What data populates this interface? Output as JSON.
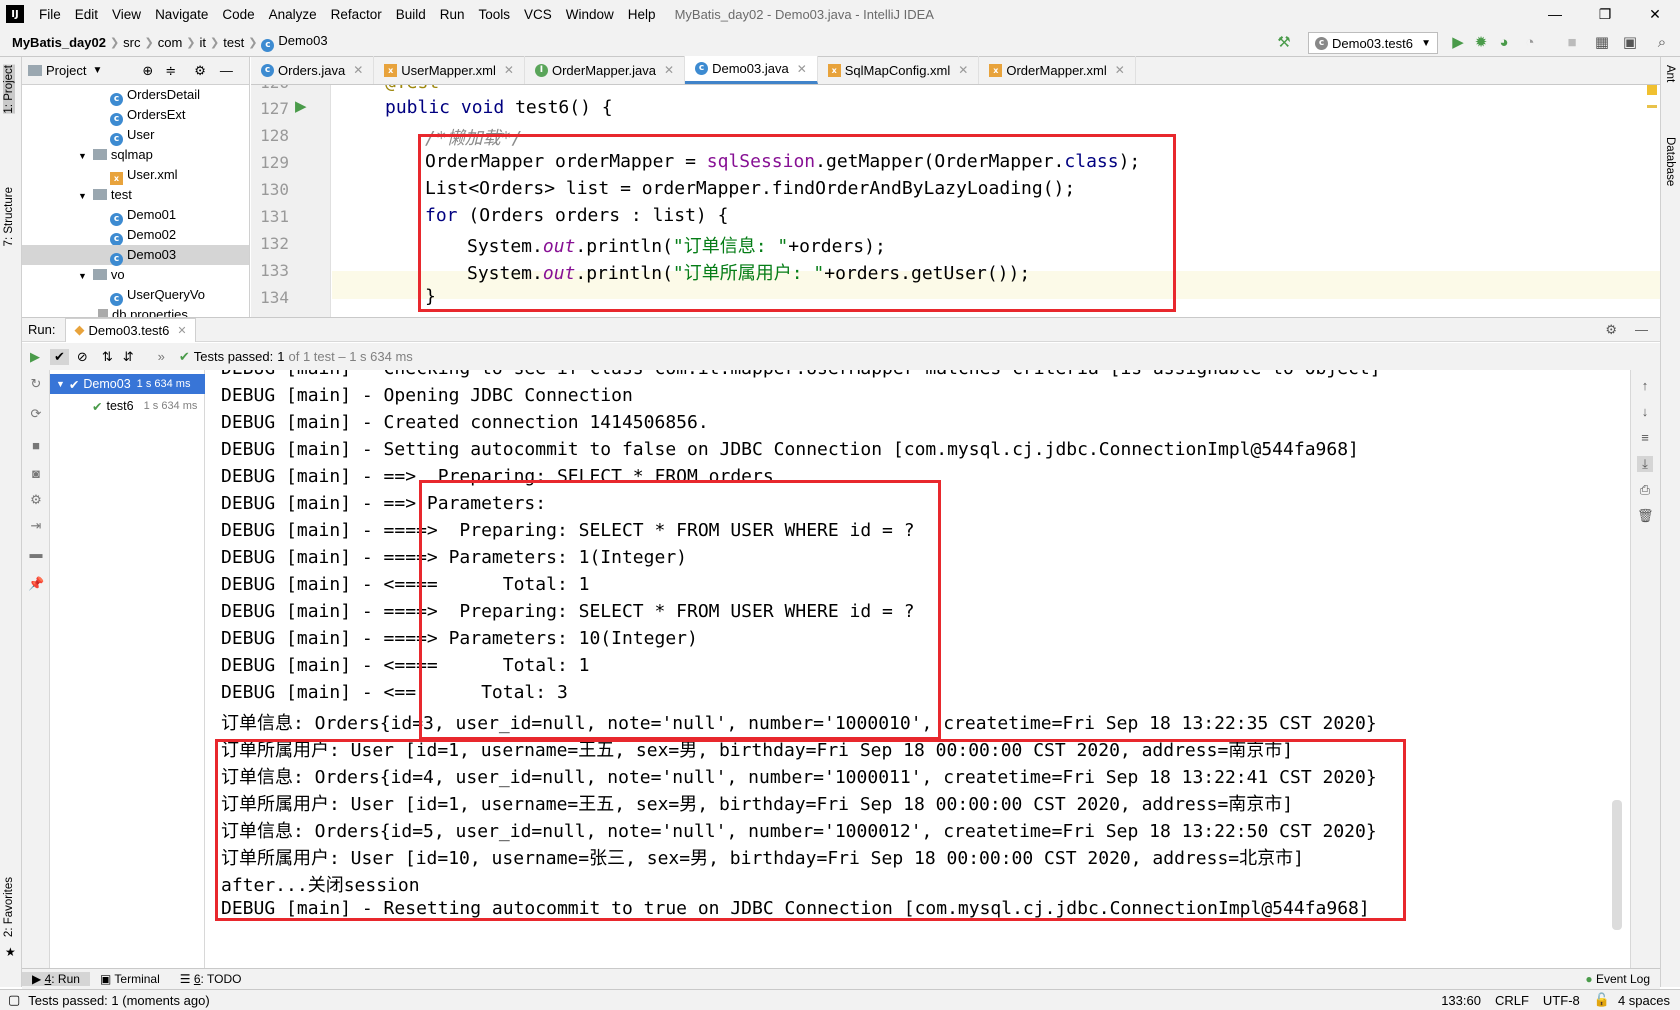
{
  "app": {
    "window_title": "MyBatis_day02 - Demo03.java - IntelliJ IDEA",
    "logo_text": "IJ",
    "menu": [
      "File",
      "Edit",
      "View",
      "Navigate",
      "Code",
      "Analyze",
      "Refactor",
      "Build",
      "Run",
      "Tools",
      "VCS",
      "Window",
      "Help"
    ]
  },
  "breadcrumb": [
    "MyBatis_day02",
    "src",
    "com",
    "it",
    "test",
    "Demo03"
  ],
  "run_config": "Demo03.test6",
  "left_strip": {
    "project": "1: Project",
    "structure": "7: Structure",
    "favorites": "2: Favorites"
  },
  "right_strip": {
    "ant": "Ant",
    "database": "Database"
  },
  "project_panel": {
    "title": "Project",
    "items": [
      {
        "label": "OrdersDetail",
        "type": "class"
      },
      {
        "label": "OrdersExt",
        "type": "class"
      },
      {
        "label": "User",
        "type": "class"
      },
      {
        "label": "sqlmap",
        "type": "folder"
      },
      {
        "label": "User.xml",
        "type": "xml"
      },
      {
        "label": "test",
        "type": "folder"
      },
      {
        "label": "Demo01",
        "type": "class"
      },
      {
        "label": "Demo02",
        "type": "class"
      },
      {
        "label": "Demo03",
        "type": "class"
      },
      {
        "label": "vo",
        "type": "folder"
      },
      {
        "label": "UserQueryVo",
        "type": "class"
      },
      {
        "label": "db.properties",
        "type": "file"
      }
    ]
  },
  "editor_tabs": [
    {
      "label": "Orders.java",
      "type": "class"
    },
    {
      "label": "UserMapper.xml",
      "type": "xml"
    },
    {
      "label": "OrderMapper.java",
      "type": "interface"
    },
    {
      "label": "Demo03.java",
      "type": "class",
      "active": true
    },
    {
      "label": "SqlMapConfig.xml",
      "type": "xml"
    },
    {
      "label": "OrderMapper.xml",
      "type": "xml"
    }
  ],
  "editor": {
    "line_numbers": [
      "126",
      "127",
      "128",
      "129",
      "130",
      "131",
      "132",
      "133",
      "134"
    ],
    "lines": {
      "l126": "@Test",
      "l127_kw1": "public",
      "l127_kw2": "void",
      "l127_rest": "test6() {",
      "l128_comment": "/*懒加载*/",
      "l129_a": "OrderMapper orderMapper = ",
      "l129_b": "sqlSession",
      "l129_c": ".getMapper(OrderMapper.",
      "l129_d": "class",
      "l129_e": ");",
      "l130": "List<Orders> list = orderMapper.findOrderAndByLazyLoading();",
      "l131_kw": "for",
      "l131_rest": " (Orders orders : list) {",
      "l132_a": "System.",
      "l132_b": "out",
      "l132_c": ".println(",
      "l132_d": "\"订单信息: \"",
      "l132_e": "+orders);",
      "l133_a": "System.",
      "l133_b": "out",
      "l133_c": ".println(",
      "l133_d": "\"订单所属用户: \"",
      "l133_e": "+orders.getUser());",
      "l134": "}"
    }
  },
  "run_panel": {
    "label": "Run:",
    "tab": "Demo03.test6",
    "tests_passed_prefix": "Tests passed:",
    "tests_passed_count": "1",
    "tests_passed_detail": "of 1 test – 1 s 634 ms",
    "tree": [
      {
        "label": "Demo03",
        "time": "1 s 634 ms"
      },
      {
        "label": "test6",
        "time": "1 s 634 ms"
      }
    ]
  },
  "console_lines": [
    "DEBUG [main] - Checking to see if class com.it.mapper.UserMapper matches criteria [is assignable to Object]",
    "DEBUG [main] - Opening JDBC Connection",
    "DEBUG [main] - Created connection 1414506856.",
    "DEBUG [main] - Setting autocommit to false on JDBC Connection [com.mysql.cj.jdbc.ConnectionImpl@544fa968]",
    "DEBUG [main] - ==>  Preparing: SELECT * FROM orders ",
    "DEBUG [main] - ==> Parameters: ",
    "DEBUG [main] - ====>  Preparing: SELECT * FROM USER WHERE id = ? ",
    "DEBUG [main] - ====> Parameters: 1(Integer)",
    "DEBUG [main] - <====      Total: 1",
    "DEBUG [main] - ====>  Preparing: SELECT * FROM USER WHERE id = ? ",
    "DEBUG [main] - ====> Parameters: 10(Integer)",
    "DEBUG [main] - <====      Total: 1",
    "DEBUG [main] - <==      Total: 3",
    "订单信息: Orders{id=3, user_id=null, note='null', number='1000010', createtime=Fri Sep 18 13:22:35 CST 2020}",
    "订单所属用户: User [id=1, username=王五, sex=男, birthday=Fri Sep 18 00:00:00 CST 2020, address=南京市]",
    "订单信息: Orders{id=4, user_id=null, note='null', number='1000011', createtime=Fri Sep 18 13:22:41 CST 2020}",
    "订单所属用户: User [id=1, username=王五, sex=男, birthday=Fri Sep 18 00:00:00 CST 2020, address=南京市]",
    "订单信息: Orders{id=5, user_id=null, note='null', number='1000012', createtime=Fri Sep 18 13:22:50 CST 2020}",
    "订单所属用户: User [id=10, username=张三, sex=男, birthday=Fri Sep 18 00:00:00 CST 2020, address=北京市]",
    "after...关闭session",
    "DEBUG [main] - Resetting autocommit to true on JDBC Connection [com.mysql.cj.jdbc.ConnectionImpl@544fa968]"
  ],
  "bottom_tabs": [
    {
      "prefix": "4",
      "label": ": Run"
    },
    {
      "prefix": "",
      "label": "Terminal"
    },
    {
      "prefix": "6",
      "label": ": TODO"
    }
  ],
  "event_log": "Event Log",
  "status": {
    "message": "Tests passed: 1 (moments ago)",
    "position": "133:60",
    "line_sep": "CRLF",
    "encoding": "UTF-8",
    "indent": "4 spaces"
  },
  "colors": {
    "highlight_box": "#e8282d",
    "keyword": "#000080",
    "string": "#067d17",
    "pass_green": "#4a9b4a"
  }
}
